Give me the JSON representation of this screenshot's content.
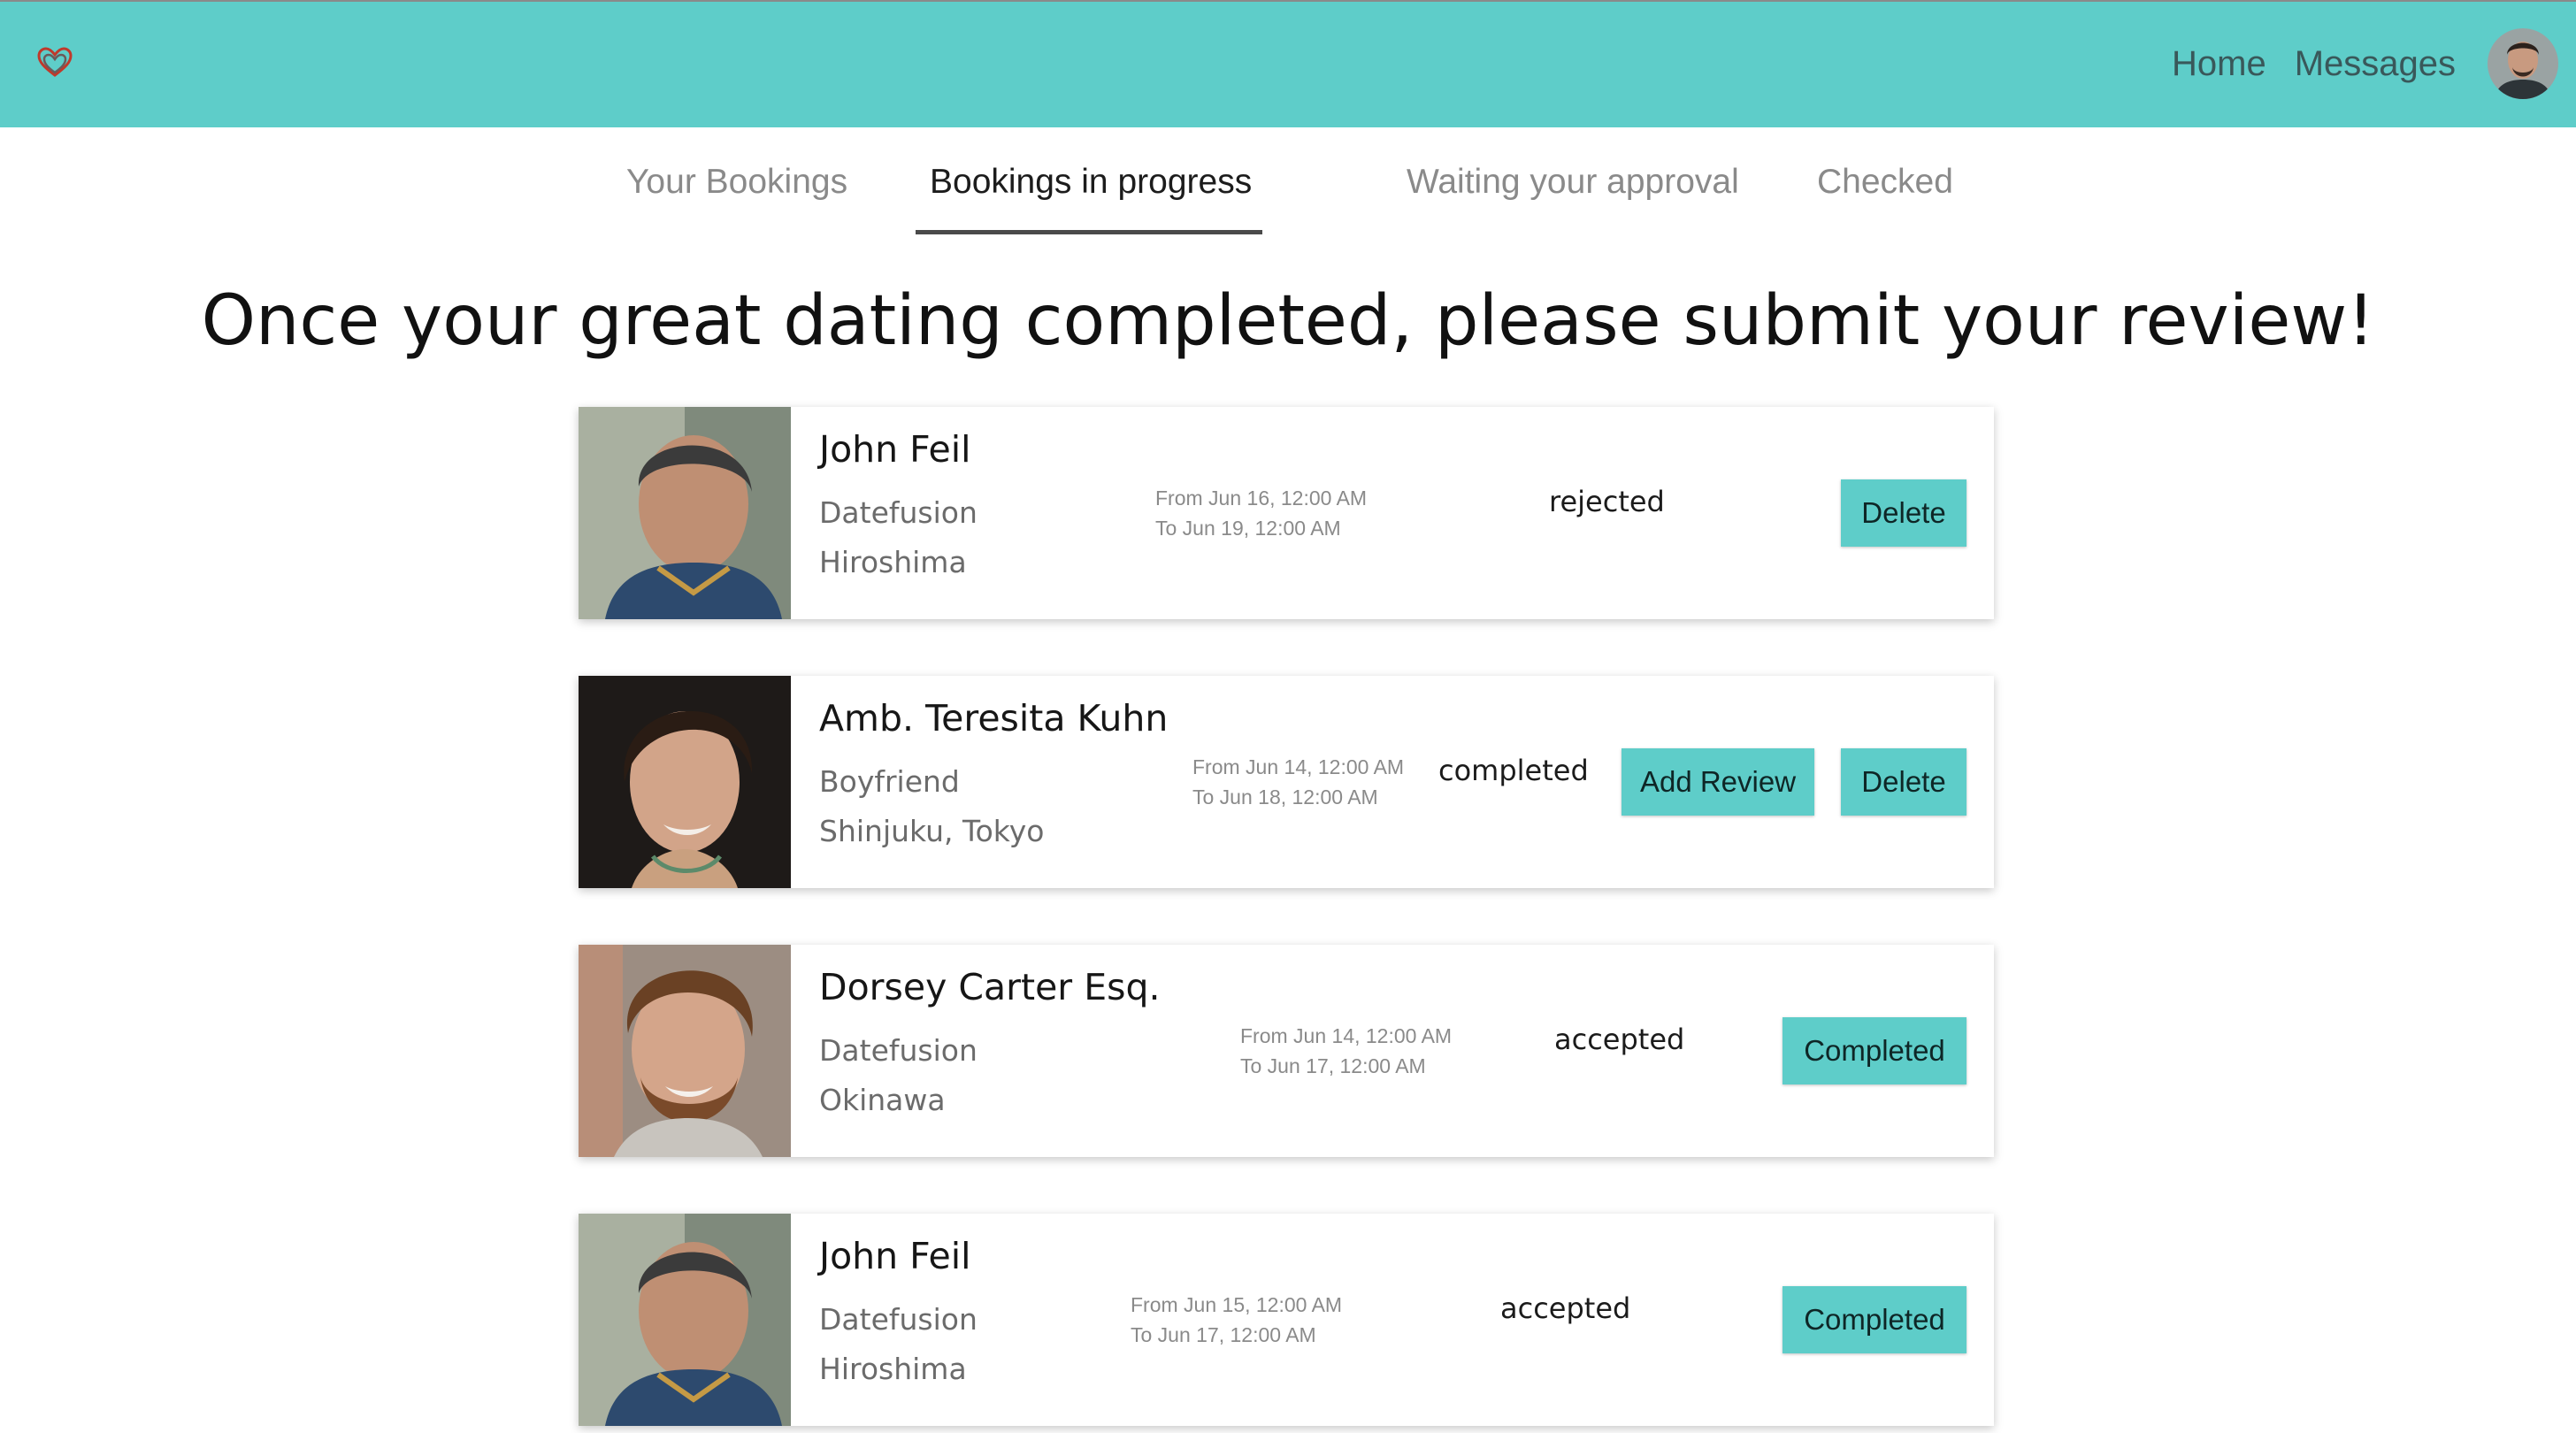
{
  "nav": {
    "home_label": "Home",
    "messages_label": "Messages"
  },
  "tabs": [
    {
      "label": "Your Bookings",
      "active": false
    },
    {
      "label": "Bookings in progress",
      "active": true
    },
    {
      "label": "Waiting your approval",
      "active": false
    },
    {
      "label": "Checked",
      "active": false
    }
  ],
  "heading": "Once your great dating completed, please submit your review!",
  "colors": {
    "accent": "#5ecdc9",
    "logo": "#c0392b"
  },
  "bookings": [
    {
      "name": "John Feil",
      "category": "Datefusion",
      "location": "Hiroshima",
      "from": "From Jun 16, 12:00 AM",
      "to": "To Jun 19, 12:00 AM",
      "status": "rejected",
      "primary_action": "",
      "secondary_action": "Delete"
    },
    {
      "name": "Amb. Teresita Kuhn",
      "category": "Boyfriend",
      "location": "Shinjuku, Tokyo",
      "from": "From Jun 14, 12:00 AM",
      "to": "To Jun 18, 12:00 AM",
      "status": "completed",
      "primary_action": "Add Review",
      "secondary_action": "Delete"
    },
    {
      "name": "Dorsey Carter Esq.",
      "category": "Datefusion",
      "location": "Okinawa",
      "from": "From Jun 14, 12:00 AM",
      "to": "To Jun 17, 12:00 AM",
      "status": "accepted",
      "primary_action": "",
      "secondary_action": "Completed"
    },
    {
      "name": "John Feil",
      "category": "Datefusion",
      "location": "Hiroshima",
      "from": "From Jun 15, 12:00 AM",
      "to": "To Jun 17, 12:00 AM",
      "status": "accepted",
      "primary_action": "",
      "secondary_action": "Completed"
    }
  ]
}
